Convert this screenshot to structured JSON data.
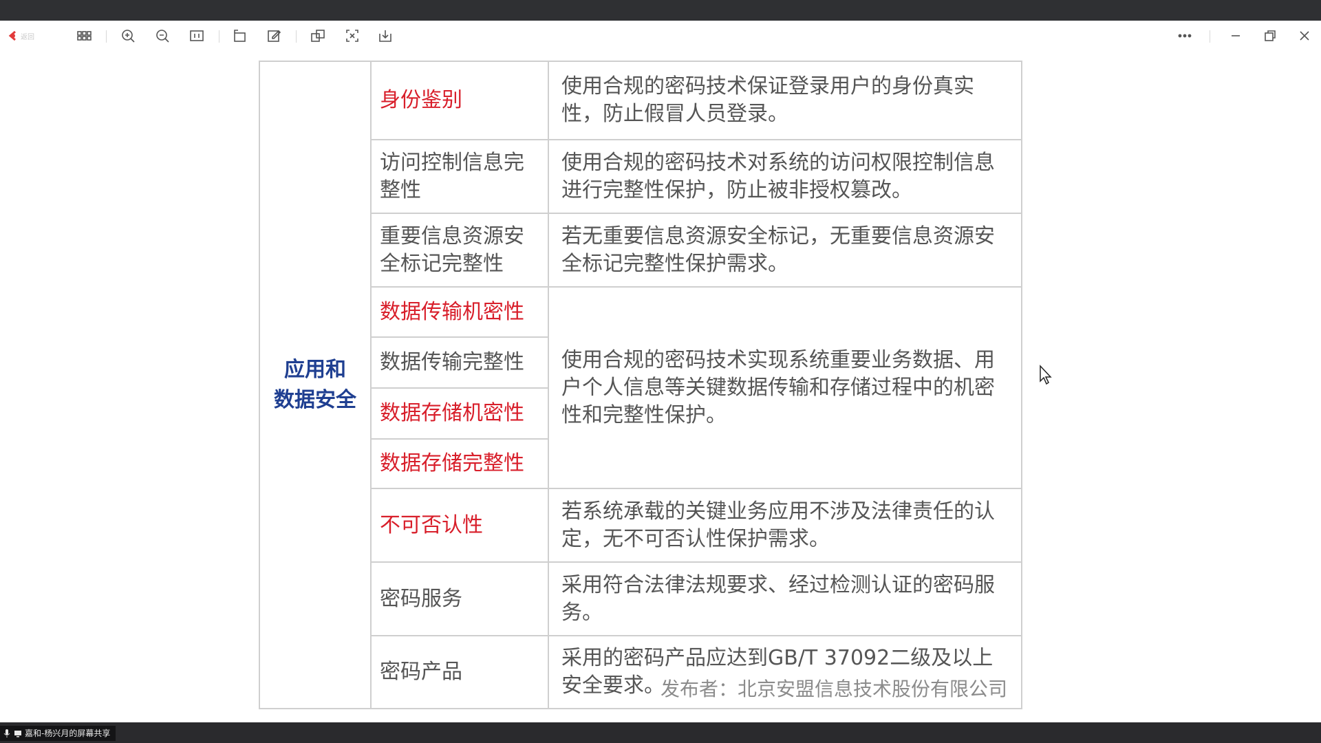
{
  "toolbar": {
    "back_label": "返回",
    "icons": [
      "grid-icon",
      "zoom-in-icon",
      "zoom-out-icon",
      "fit-page-icon",
      "rotate-icon",
      "edit-icon",
      "translate-icon",
      "screenshot-icon",
      "download-icon",
      "more-icon",
      "minimize-icon",
      "restore-icon",
      "close-icon"
    ]
  },
  "table": {
    "category": "应用和数据安全",
    "category_lines": [
      "应用和",
      "数据安全"
    ],
    "rows": [
      {
        "item": "身份鉴别",
        "desc": "使用合规的密码技术保证登录用户的身份真实性，防止假冒人员登录。"
      },
      {
        "item": "访问控制信息完整性",
        "desc": "使用合规的密码技术对系统的访问权限控制信息进行完整性保护，防止被非授权篡改。"
      },
      {
        "item": "重要信息资源安全标记完整性",
        "desc": "若无重要信息资源安全标记，无重要信息资源安全标记完整性保护需求。"
      },
      {
        "item": "数据传输机密性",
        "desc": "使用合规的密码技术实现系统重要业务数据、用户个人信息等关键数据传输和存储过程中的机密性和完整性保护。"
      },
      {
        "item": "数据传输完整性"
      },
      {
        "item": "数据存储机密性"
      },
      {
        "item": "数据存储完整性"
      },
      {
        "item": "不可否认性",
        "desc": "若系统承载的关键业务应用不涉及法律责任的认定，无不可否认性保护需求。"
      },
      {
        "item": "密码服务",
        "desc": "采用符合法律法规要求、经过检测认证的密码服务。"
      },
      {
        "item": "密码产品",
        "desc": "采用的密码产品应达到GB/T  37092二级及以上安全要求。"
      }
    ]
  },
  "watermark": "发布者：北京安盟信息技术股份有限公司",
  "bottombar": {
    "share_label": "嘉和-杨兴月的屏幕共享"
  },
  "colors": {
    "category": "#1f3f91",
    "highlight": "#d81e2a",
    "text": "#555555"
  }
}
